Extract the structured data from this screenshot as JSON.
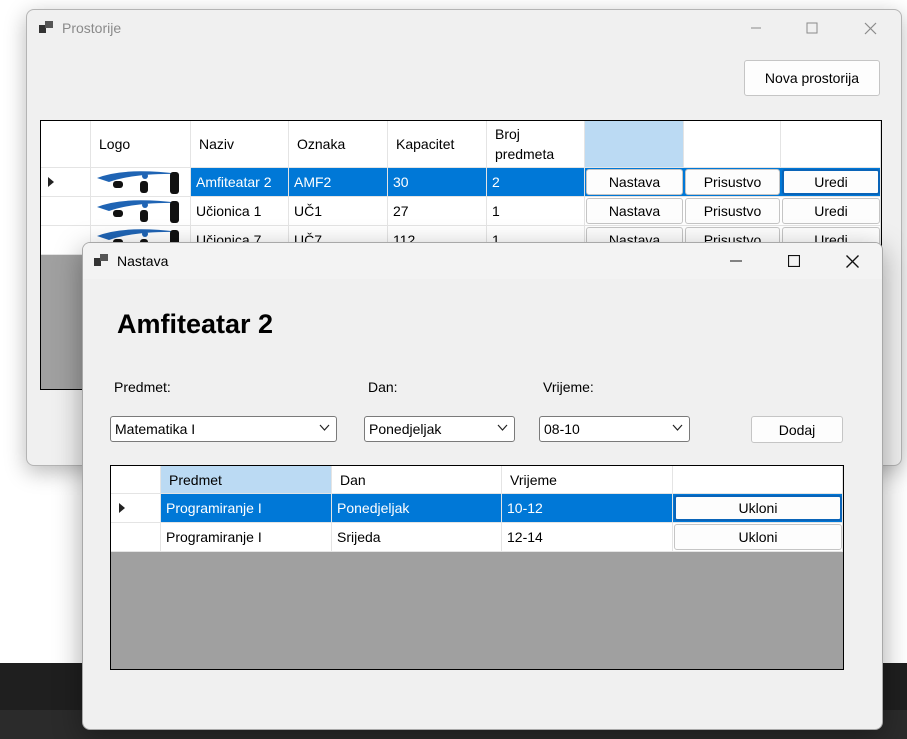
{
  "back_window": {
    "title": "Prostorije",
    "new_button": "Nova prostorija",
    "columns": [
      "Logo",
      "Naziv",
      "Oznaka",
      "Kapacitet",
      "Broj predmeta",
      "",
      "",
      ""
    ],
    "rows": [
      {
        "naziv": "Amfiteatar 2",
        "oznaka": "AMF2",
        "kapacitet": "30",
        "broj": "2",
        "b1": "Nastava",
        "b2": "Prisustvo",
        "b3": "Uredi"
      },
      {
        "naziv": "Učionica 1",
        "oznaka": "UČ1",
        "kapacitet": "27",
        "broj": "1",
        "b1": "Nastava",
        "b2": "Prisustvo",
        "b3": "Uredi"
      },
      {
        "naziv": "Učionica 7",
        "oznaka": "UČ7",
        "kapacitet": "112",
        "broj": "1",
        "b1": "Nastava",
        "b2": "Prisustvo",
        "b3": "Uredi"
      }
    ]
  },
  "front_window": {
    "title": "Nastava",
    "heading": "Amfiteatar 2",
    "labels": {
      "predmet": "Predmet:",
      "dan": "Dan:",
      "vrijeme": "Vrijeme:"
    },
    "selects": {
      "predmet": "Matematika I",
      "dan": "Ponedjeljak",
      "vrijeme": "08-10"
    },
    "add_button": "Dodaj",
    "columns": [
      "Predmet",
      "Dan",
      "Vrijeme",
      ""
    ],
    "rows": [
      {
        "predmet": "Programiranje I",
        "dan": "Ponedjeljak",
        "vrijeme": "10-12",
        "action": "Ukloni"
      },
      {
        "predmet": "Programiranje I",
        "dan": "Srijeda",
        "vrijeme": "12-14",
        "action": "Ukloni"
      }
    ]
  },
  "colors": {
    "selection": "#0078d7",
    "header_selected": "#bbdaf3",
    "grid_bg": "#a0a0a0"
  }
}
